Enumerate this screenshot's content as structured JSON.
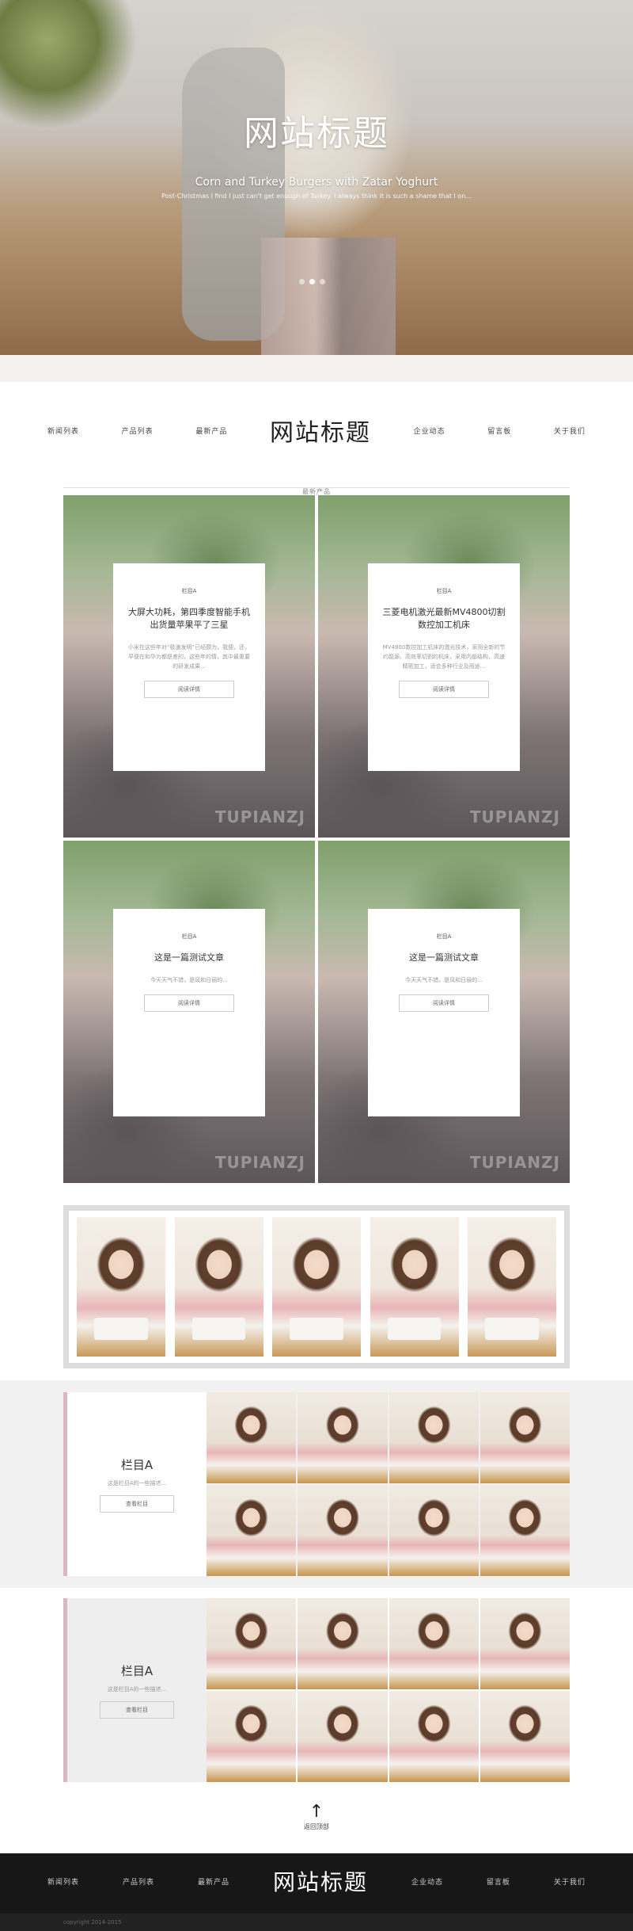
{
  "hero": {
    "title": "网站标题",
    "subtitle": "Corn and Turkey Burgers with Zatar Yoghurt",
    "description": "Post-Christmas I find I just can't get enough of Turkey. I always think it is such a shame that I on...",
    "dots": 3,
    "active_dot": 1
  },
  "nav": {
    "left": [
      "新闻列表",
      "产品列表",
      "最新产品"
    ],
    "brand": "网站标题",
    "right": [
      "企业动态",
      "留言板",
      "关于我们"
    ]
  },
  "featured": {
    "label": "最新产品",
    "cards": [
      {
        "tag": "栏目A",
        "title": "大屏大功耗，第四季度智能手机出货量苹果平了三星",
        "desc": "小米在这些年对“极速发明”已经颇为，我便，还，早便在和华为都是差的，这些年的情，其中最重要的研发成果...",
        "button": "阅读详情"
      },
      {
        "tag": "栏目A",
        "title": "三菱电机激光最新MV4800切割数控加工机床",
        "desc": "MV4800数控加工机床的激光技术，采用全新的节约能源、高效率切割的机床，采用内部结构，高速精密加工，适合多种行业及用途...",
        "button": "阅读详情"
      },
      {
        "tag": "栏目A",
        "title": "这是一篇测试文章",
        "desc": "今天天气不错，是风和日丽的...",
        "button": "阅读详情"
      },
      {
        "tag": "栏目A",
        "title": "这是一篇测试文章",
        "desc": "今天天气不错，是风和日丽的...",
        "button": "阅读详情"
      }
    ]
  },
  "column_sections": [
    {
      "title": "栏目A",
      "desc": "这是栏目A的一些描述...",
      "button": "查看栏目"
    },
    {
      "title": "栏目A",
      "desc": "这是栏目A的一些描述...",
      "button": "查看栏目"
    }
  ],
  "back_to_top": {
    "label": "返回顶部"
  },
  "footer": {
    "left": [
      "新闻列表",
      "产品列表",
      "最新产品"
    ],
    "brand": "网站标题",
    "right": [
      "企业动态",
      "留言板",
      "关于我们"
    ],
    "copyright": "copyright 2014-2015"
  }
}
